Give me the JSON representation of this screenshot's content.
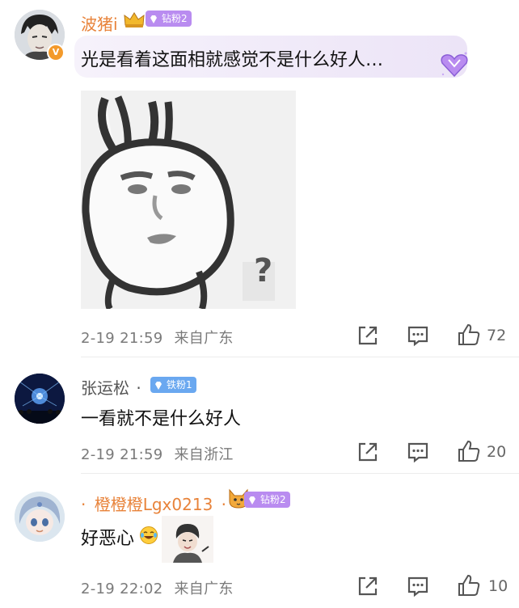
{
  "comments": [
    {
      "username": "波猪i",
      "fan_badge": "钻粉2",
      "text": "光是看着这面相就感觉不是什么好人…",
      "date": "2-19 21:59",
      "location": "来自广东",
      "likes": "72",
      "has_image": true,
      "sticker_caption": "?"
    },
    {
      "username": "张运松",
      "username_suffix": "·",
      "fan_badge": "铁粉1",
      "text": "一看就不是什么好人",
      "date": "2-19 21:59",
      "location": "来自浙江",
      "likes": "20"
    },
    {
      "username_prefix": "·",
      "username": "橙橙橙Lgx0213",
      "username_suffix": "·",
      "fan_badge": "钻粉2",
      "text": "好恶心",
      "date": "2-19 22:02",
      "location": "来自广东",
      "likes": "10"
    }
  ],
  "colors": {
    "orange_name": "#e8833a",
    "diamond_badge": "#b98cf0",
    "iron_badge": "#6aa8f0",
    "meta_gray": "#7a7a7a"
  }
}
